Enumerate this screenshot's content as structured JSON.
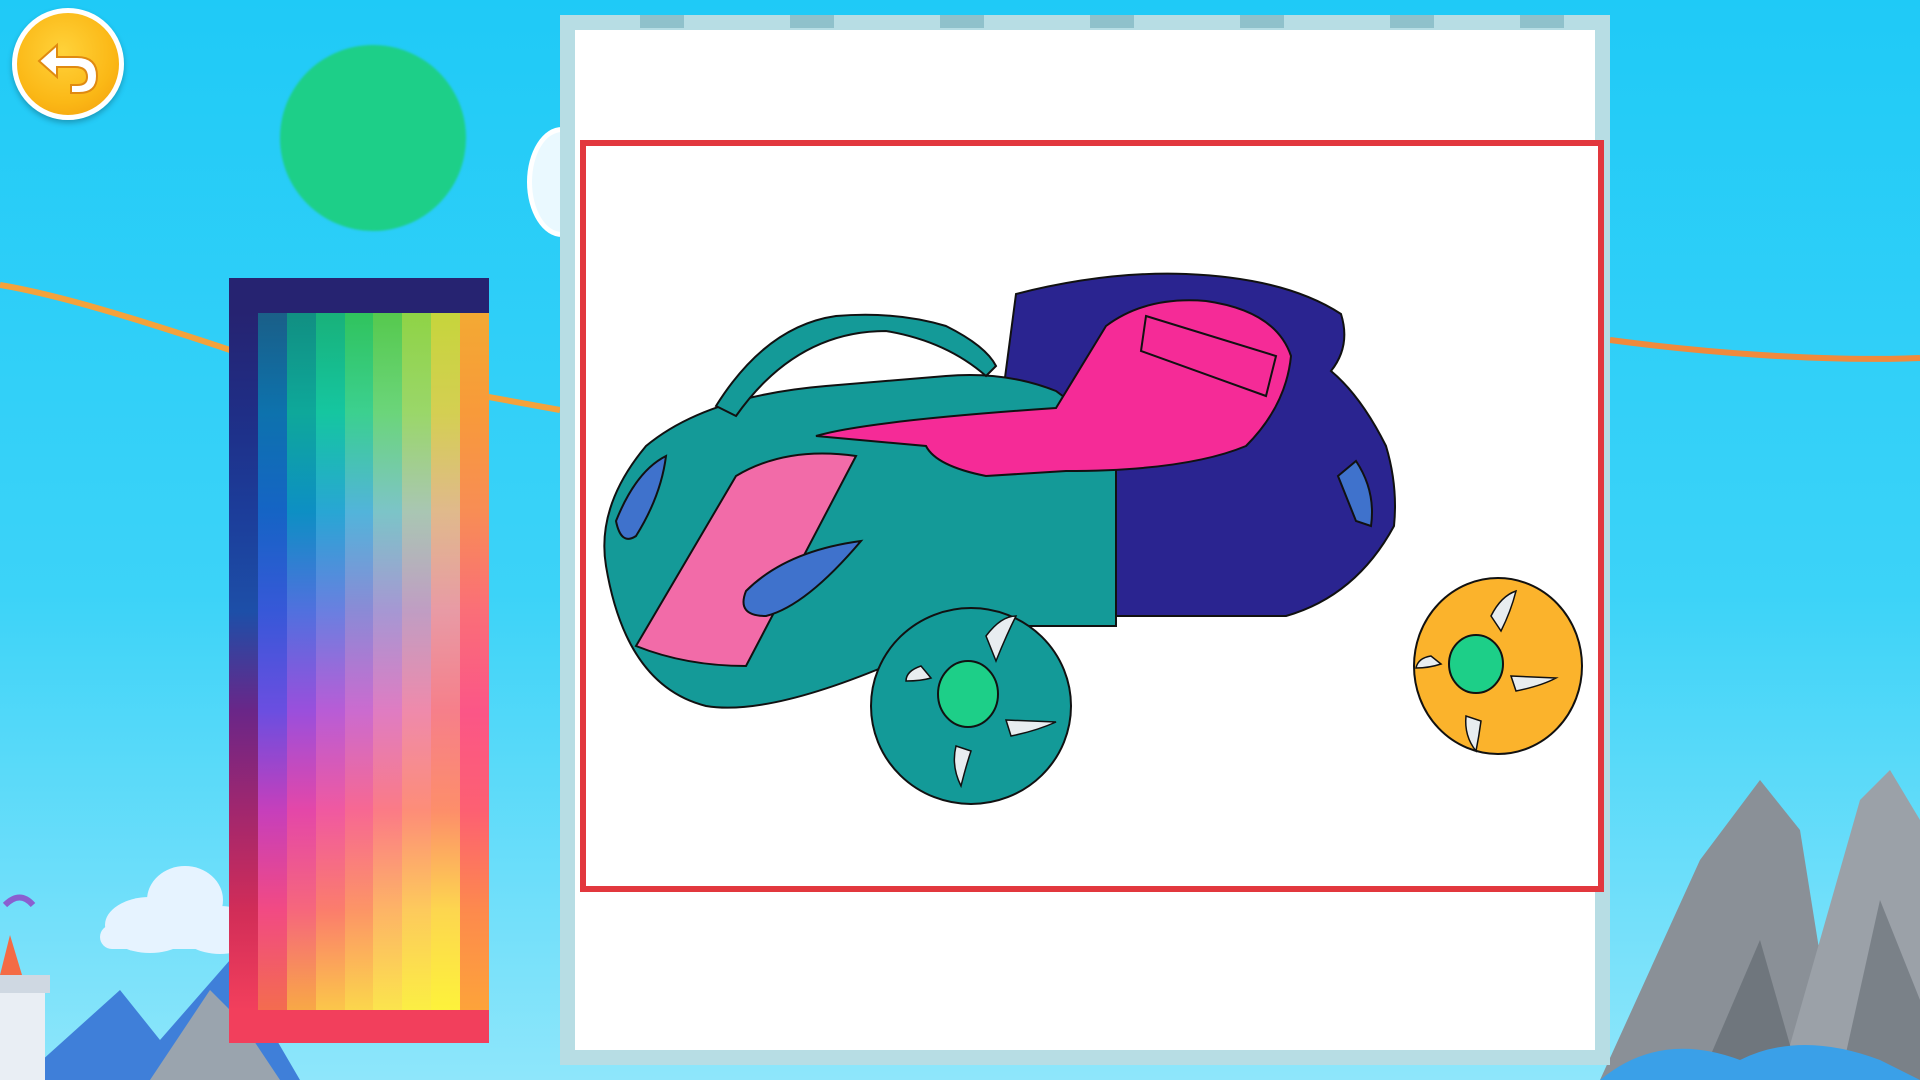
{
  "app": {
    "back_icon": "undo-arrow-icon",
    "selected_color": "#1dcf88"
  },
  "palette": {
    "header_color": "#262371",
    "footer_color": "#f23f5c",
    "columns": [
      [
        "#262371",
        "#1f2e86",
        "#1c3d9a",
        "#1d4fa8",
        "#6a2688",
        "#a1276e",
        "#d12d58",
        "#f23f5c"
      ],
      [
        "#1a5f88",
        "#0d72ad",
        "#1564c5",
        "#3758d8",
        "#6b4ee0",
        "#c63fbb",
        "#f24a83",
        "#f36c4f"
      ],
      [
        "#118f82",
        "#0ea89a",
        "#0d8fc4",
        "#5170de",
        "#9a4fdc",
        "#e447a8",
        "#f6677c",
        "#f8a846"
      ],
      [
        "#18b17a",
        "#15c6a0",
        "#28a6d4",
        "#6a7fe0",
        "#b85cd6",
        "#f059a0",
        "#fb7d6c",
        "#fbc64a"
      ],
      [
        "#30c35d",
        "#3cd08f",
        "#52b4da",
        "#8b8ad6",
        "#cb6bcf",
        "#f76892",
        "#fc9566",
        "#fbd64c"
      ],
      [
        "#56c94e",
        "#6bd57a",
        "#7cc4c8",
        "#a697d3",
        "#df7cc2",
        "#fb7b86",
        "#fdb466",
        "#fbe44d"
      ],
      [
        "#8fd346",
        "#9ad769",
        "#a9c6b3",
        "#c09dc3",
        "#ef8aab",
        "#fd8d78",
        "#fdca5c",
        "#fbee44"
      ],
      [
        "#c6d53c",
        "#d4cf52",
        "#e0b98c",
        "#e89aa5",
        "#f67f8a",
        "#fd8e6a",
        "#fdd64f",
        "#fdf23b"
      ],
      [
        "#f3a933",
        "#f89a3a",
        "#f88d55",
        "#fa6e78",
        "#fb5687",
        "#fd6072",
        "#fd8a4d",
        "#fda33a"
      ]
    ]
  },
  "coloring_page": {
    "subject": "car",
    "colors": {
      "body_front": "#149a98",
      "body_rear": "#2a2490",
      "seats": "#f52b97",
      "hood_stripe": "#f26ba8",
      "windows": "#3f72cc",
      "wheel_front": "#139a98",
      "wheel_rear": "#fbb32c",
      "hub": "#1dcf88",
      "frame_border": "#e2383e"
    }
  }
}
